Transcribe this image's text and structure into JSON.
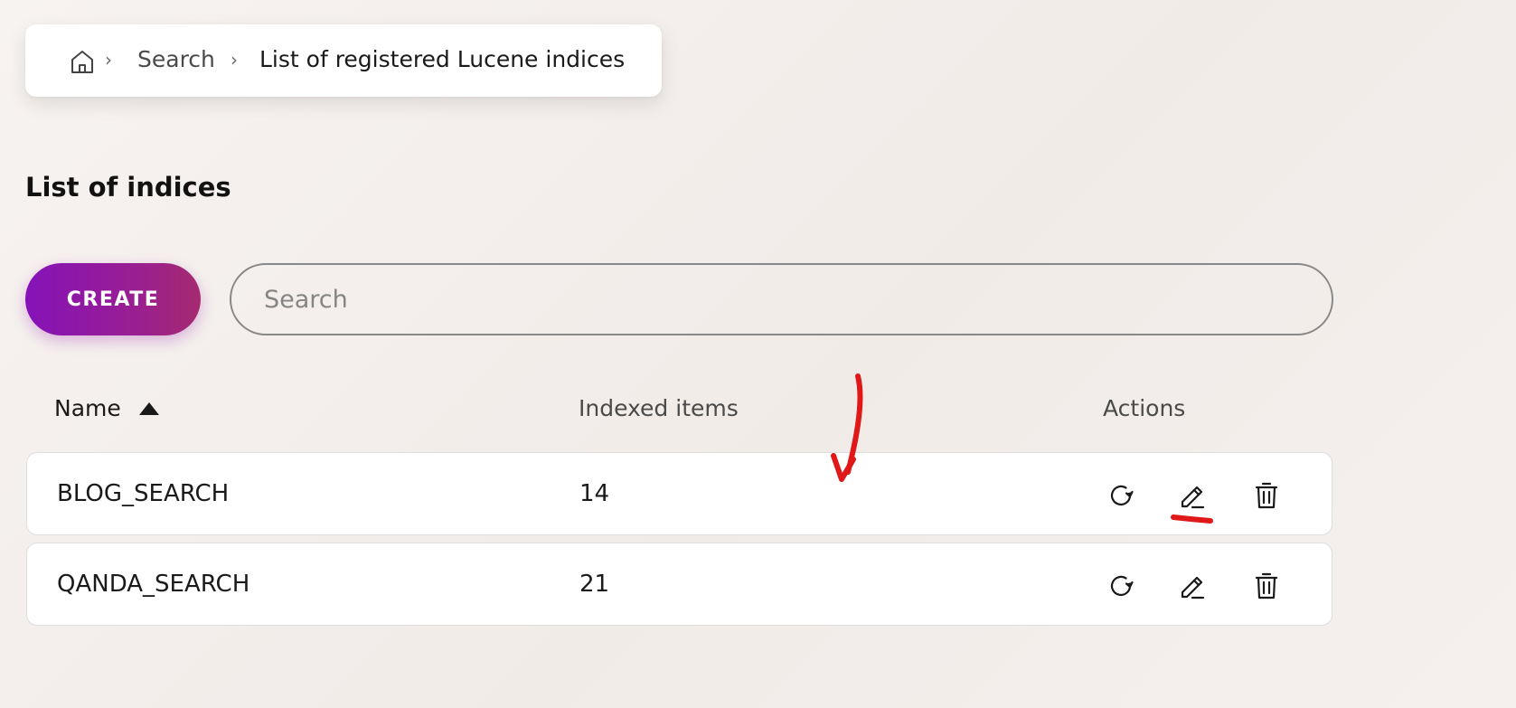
{
  "breadcrumb": {
    "home_icon": "home-icon",
    "separator": "›",
    "items": [
      "Search",
      "List of registered Lucene indices"
    ]
  },
  "page": {
    "title": "List of indices"
  },
  "toolbar": {
    "create_label": "CREATE",
    "search_placeholder": "Search"
  },
  "table": {
    "columns": [
      "Name",
      "Indexed items",
      "Actions"
    ],
    "sort": {
      "column": "Name",
      "direction": "ascending",
      "icon": "sort-ascending-icon"
    },
    "rows": [
      {
        "name": "BLOG_SEARCH",
        "indexed_items": "14"
      },
      {
        "name": "QANDA_SEARCH",
        "indexed_items": "21"
      }
    ],
    "action_icons": [
      "refresh-icon",
      "edit-icon",
      "delete-icon"
    ]
  },
  "colors": {
    "accent_gradient_start": "#8512b8",
    "accent_gradient_end": "#a52a70",
    "annotation": "#e01818",
    "background": "#f3eeeb"
  }
}
